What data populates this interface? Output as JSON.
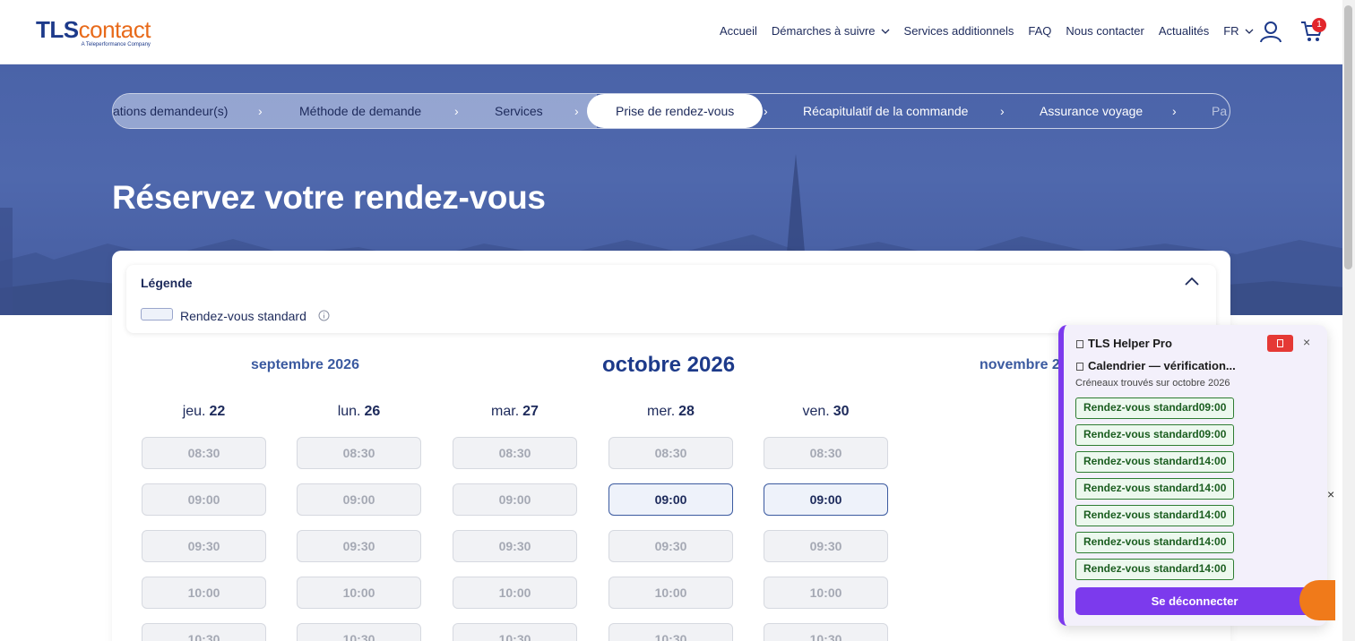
{
  "logo": {
    "main_a": "TLS",
    "main_b": "contact",
    "sub": "A Teleperformance Company"
  },
  "nav": {
    "items": [
      "Accueil",
      "Démarches à suivre",
      "Services additionnels",
      "FAQ",
      "Nous contacter",
      "Actualités",
      "FR"
    ],
    "cart_count": "1"
  },
  "stepper": {
    "steps": [
      "ations demandeur(s)",
      "Méthode de demande",
      "Services",
      "Prise de rendez-vous",
      "Récapitulatif de la commande",
      "Assurance voyage",
      "Pa"
    ],
    "active_index": 3,
    "arrow": "›"
  },
  "hero": {
    "title": "Réservez votre rendez-vous"
  },
  "legend": {
    "title": "Légende",
    "standard_label": "Rendez-vous standard"
  },
  "calendar": {
    "prev_month": "septembre 2026",
    "current_month": "octobre 2026",
    "next_month": "novembre 2",
    "columns": [
      {
        "day": "jeu.",
        "date": "22"
      },
      {
        "day": "lun.",
        "date": "26"
      },
      {
        "day": "mar.",
        "date": "27"
      },
      {
        "day": "mer.",
        "date": "28"
      },
      {
        "day": "ven.",
        "date": "30"
      }
    ],
    "times": [
      "08:30",
      "09:00",
      "09:30",
      "10:00",
      "10:30"
    ],
    "available": [
      [
        3,
        1
      ],
      [
        4,
        1
      ]
    ]
  },
  "helper": {
    "title": "TLS Helper Pro",
    "close": "×",
    "status": "Calendrier — vérification...",
    "subtitle": "Créneaux trouvés sur octobre 2026",
    "slots": [
      "Rendez-vous standard09:00",
      "Rendez-vous standard09:00",
      "Rendez-vous standard14:00",
      "Rendez-vous standard14:00",
      "Rendez-vous standard14:00",
      "Rendez-vous standard14:00",
      "Rendez-vous standard14:00"
    ],
    "logout_label": "Se déconnecter"
  },
  "colors": {
    "brand_blue": "#1d3a8a",
    "brand_orange": "#e86a1a",
    "helper_purple": "#7c3aed",
    "slot_green": "#2e7d32"
  }
}
